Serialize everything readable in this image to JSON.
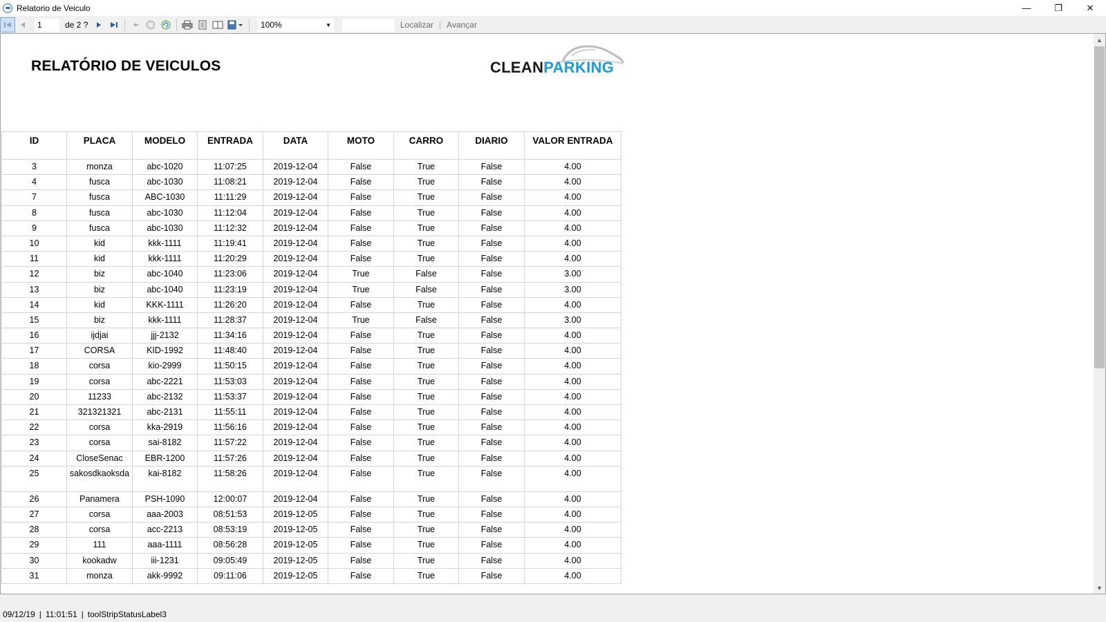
{
  "window": {
    "title": "Relatorio de Veiculo",
    "controls": {
      "minimize": "—",
      "restore": "❐",
      "close": "✕"
    }
  },
  "toolbar": {
    "current_page": "1",
    "of_pages": "de 2 ?",
    "zoom": "100%",
    "find_placeholder": "",
    "find_label": "Localizar",
    "separator": "|",
    "next_label": "Avançar",
    "icons": [
      "first-page-icon",
      "prev-page-icon",
      "next-page-icon",
      "last-page-icon",
      "back-icon",
      "stop-icon",
      "refresh-icon",
      "print-icon",
      "print-layout-icon",
      "page-setup-icon",
      "export-icon"
    ]
  },
  "report": {
    "title": "RELATÓRIO DE VEICULOS",
    "logo": {
      "part1": "CLEAN",
      "part2": "PARKING"
    },
    "columns": [
      "ID",
      "PLACA",
      "MODELO",
      "ENTRADA",
      "DATA",
      "MOTO",
      "CARRO",
      "DIARIO",
      "VALOR ENTRADA"
    ],
    "rows": [
      [
        "3",
        "monza",
        "abc-1020",
        "11:07:25",
        "2019-12-04",
        "False",
        "True",
        "False",
        "4.00"
      ],
      [
        "4",
        "fusca",
        "abc-1030",
        "11:08:21",
        "2019-12-04",
        "False",
        "True",
        "False",
        "4.00"
      ],
      [
        "7",
        "fusca",
        "ABC-1030",
        "11:11:29",
        "2019-12-04",
        "False",
        "True",
        "False",
        "4.00"
      ],
      [
        "8",
        "fusca",
        "abc-1030",
        "11:12:04",
        "2019-12-04",
        "False",
        "True",
        "False",
        "4.00"
      ],
      [
        "9",
        "fusca",
        "abc-1030",
        "11:12:32",
        "2019-12-04",
        "False",
        "True",
        "False",
        "4.00"
      ],
      [
        "10",
        "kid",
        "kkk-1111",
        "11:19:41",
        "2019-12-04",
        "False",
        "True",
        "False",
        "4.00"
      ],
      [
        "11",
        "kid",
        "kkk-1111",
        "11:20:29",
        "2019-12-04",
        "False",
        "True",
        "False",
        "4.00"
      ],
      [
        "12",
        "biz",
        "abc-1040",
        "11:23:06",
        "2019-12-04",
        "True",
        "False",
        "False",
        "3.00"
      ],
      [
        "13",
        "biz",
        "abc-1040",
        "11:23:19",
        "2019-12-04",
        "True",
        "False",
        "False",
        "3.00"
      ],
      [
        "14",
        "kid",
        "KKK-1111",
        "11:26:20",
        "2019-12-04",
        "False",
        "True",
        "False",
        "4.00"
      ],
      [
        "15",
        "biz",
        "kkk-1111",
        "11:28:37",
        "2019-12-04",
        "True",
        "False",
        "False",
        "3.00"
      ],
      [
        "16",
        "ijdjai",
        "jjj-2132",
        "11:34:16",
        "2019-12-04",
        "False",
        "True",
        "False",
        "4.00"
      ],
      [
        "17",
        "CORSA",
        "KID-1992",
        "11:48:40",
        "2019-12-04",
        "False",
        "True",
        "False",
        "4.00"
      ],
      [
        "18",
        "corsa",
        "kio-2999",
        "11:50:15",
        "2019-12-04",
        "False",
        "True",
        "False",
        "4.00"
      ],
      [
        "19",
        "corsa",
        "abc-2221",
        "11:53:03",
        "2019-12-04",
        "False",
        "True",
        "False",
        "4.00"
      ],
      [
        "20",
        "11233",
        "abc-2132",
        "11:53:37",
        "2019-12-04",
        "False",
        "True",
        "False",
        "4.00"
      ],
      [
        "21",
        "321321321",
        "abc-2131",
        "11:55:11",
        "2019-12-04",
        "False",
        "True",
        "False",
        "4.00"
      ],
      [
        "22",
        "corsa",
        "kka-2919",
        "11:56:16",
        "2019-12-04",
        "False",
        "True",
        "False",
        "4.00"
      ],
      [
        "23",
        "corsa",
        "sai-8182",
        "11:57:22",
        "2019-12-04",
        "False",
        "True",
        "False",
        "4.00"
      ],
      [
        "24",
        "CloseSenac",
        "EBR-1200",
        "11:57:26",
        "2019-12-04",
        "False",
        "True",
        "False",
        "4.00"
      ],
      [
        "25",
        "sakosdkaoksda",
        "kai-8182",
        "11:58:26",
        "2019-12-04",
        "False",
        "True",
        "False",
        "4.00"
      ],
      [
        "26",
        "Panamera",
        "PSH-1090",
        "12:00:07",
        "2019-12-04",
        "False",
        "True",
        "False",
        "4.00"
      ],
      [
        "27",
        "corsa",
        "aaa-2003",
        "08:51:53",
        "2019-12-05",
        "False",
        "True",
        "False",
        "4.00"
      ],
      [
        "28",
        "corsa",
        "acc-2213",
        "08:53:19",
        "2019-12-05",
        "False",
        "True",
        "False",
        "4.00"
      ],
      [
        "29",
        "111",
        "aaa-1111",
        "08:56:28",
        "2019-12-05",
        "False",
        "True",
        "False",
        "4.00"
      ],
      [
        "30",
        "kookadw",
        "iii-1231",
        "09:05:49",
        "2019-12-05",
        "False",
        "True",
        "False",
        "4.00"
      ],
      [
        "31",
        "monza",
        "akk-9992",
        "09:11:06",
        "2019-12-05",
        "False",
        "True",
        "False",
        "4.00"
      ]
    ]
  },
  "status": {
    "date": "09/12/19",
    "time": "11:01:51",
    "label3": "toolStripStatusLabel3",
    "separator": "|"
  }
}
